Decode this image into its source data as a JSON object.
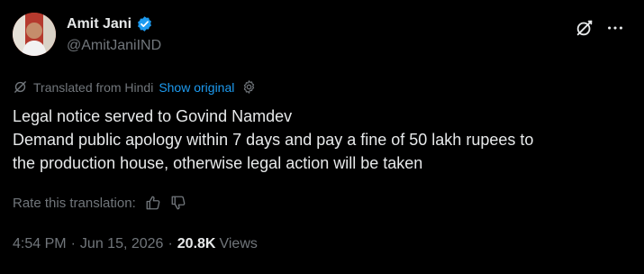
{
  "author": {
    "display_name": "Amit Jani",
    "handle": "@AmitJaniIND",
    "verified": true,
    "verified_color": "#1d9bf0"
  },
  "translation": {
    "label": "Translated from Hindi",
    "show_original": "Show original"
  },
  "post": {
    "lines": [
      "Legal notice served to Govind Namdev",
      "Demand public apology within 7 days and pay a fine of 50 lakh rupees to",
      "the production house, otherwise legal action will be taken"
    ]
  },
  "rating": {
    "label": "Rate this translation:"
  },
  "meta": {
    "time": "4:54 PM",
    "separator": "·",
    "date": "Jun 15, 2026",
    "views_count": "20.8K",
    "views_label": "Views"
  },
  "colors": {
    "background": "#000000",
    "text_primary": "#e7e9ea",
    "text_secondary": "#71767b",
    "link": "#1d9bf0"
  },
  "icons": [
    "verified-badge-icon",
    "grok-icon",
    "more-icon",
    "translate-icon",
    "settings-icon",
    "thumbs-up-icon",
    "thumbs-down-icon"
  ]
}
